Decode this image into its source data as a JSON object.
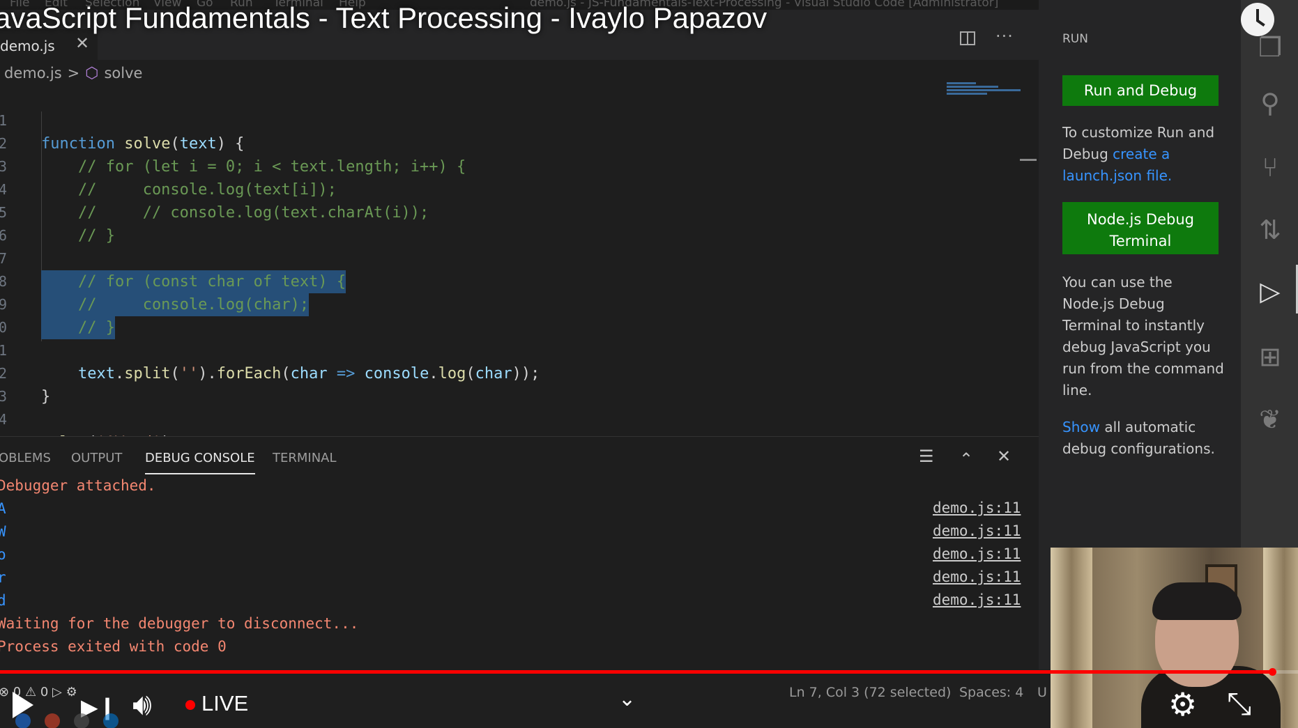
{
  "menubar": {
    "items": [
      "File",
      "Edit",
      "Selection",
      "View",
      "Go",
      "Run",
      "Terminal",
      "Help"
    ],
    "window_title": "demo.js - JS-Fundamentals-Text-Processing - Visual Studio Code [Administrator]"
  },
  "video": {
    "title": "avaScript Fundamentals - Text Processing - Ivaylo Papazov",
    "live_label": "LIVE",
    "progress": 0.98
  },
  "tab": {
    "label": "demo.js",
    "close": "✕"
  },
  "editor_actions": {
    "more": "···"
  },
  "breadcrumb": {
    "file": "demo.js",
    "separator": ">",
    "symbol": "solve"
  },
  "code_lines": [
    {
      "n": "1",
      "text": "function solve(text) {"
    },
    {
      "n": "2",
      "text": "    // for (let i = 0; i < text.length; i++) {"
    },
    {
      "n": "3",
      "text": "    //     console.log(text[i]);"
    },
    {
      "n": "4",
      "text": "    //     // console.log(text.charAt(i));"
    },
    {
      "n": "5",
      "text": "    // }"
    },
    {
      "n": "6",
      "text": ""
    },
    {
      "n": "7",
      "text": "    // for (const char of text) {"
    },
    {
      "n": "8",
      "text": "    //     console.log(char);"
    },
    {
      "n": "9",
      "text": "    // }"
    },
    {
      "n": "0",
      "text": ""
    },
    {
      "n": "1",
      "text": "    text.split('').forEach(char => console.log(char));"
    },
    {
      "n": "2",
      "text": "}"
    },
    {
      "n": "3",
      "text": ""
    },
    {
      "n": "4",
      "text": "solve('AWord');"
    }
  ],
  "panel": {
    "tabs": [
      "OBLEMS",
      "OUTPUT",
      "DEBUG CONSOLE",
      "TERMINAL"
    ],
    "active_tab": "DEBUG CONSOLE",
    "icons": {
      "clear": "☰",
      "maximize": "⌃",
      "close": "✕"
    },
    "console_lines": [
      {
        "text": "Debugger attached.",
        "kind": "red"
      },
      {
        "text": "A",
        "kind": "blue"
      },
      {
        "text": "W",
        "kind": "blue"
      },
      {
        "text": "o",
        "kind": "blue"
      },
      {
        "text": "r",
        "kind": "blue"
      },
      {
        "text": "d",
        "kind": "blue"
      },
      {
        "text": "Waiting for the debugger to disconnect...",
        "kind": "red"
      },
      {
        "text": "Process exited with code 0",
        "kind": "red"
      }
    ],
    "source_links": [
      "demo.js:11",
      "demo.js:11",
      "demo.js:11",
      "demo.js:11",
      "demo.js:11"
    ]
  },
  "run_view": {
    "title": "RUN",
    "run_debug_button": "Run and Debug",
    "customize_text": "To customize Run and Debug ",
    "customize_link": "create a launch.json file.",
    "node_terminal_button_line1": "Node.js Debug",
    "node_terminal_button_line2": "Terminal",
    "node_terminal_desc": "You can use the Node.js Debug Terminal to instantly debug JavaScript you run from the command line.",
    "show_link": "Show",
    "show_text": " all automatic debug configurations."
  },
  "status_bar": {
    "left": "⊗ 0 ⚠ 0   ▷  ⚙",
    "position": "Ln 7, Col 3 (72 selected)",
    "spaces": "Spaces: 4",
    "encoding_partial": "U"
  },
  "colors": {
    "accent_green": "#0e7a0d",
    "link_blue": "#3794ff",
    "console_red": "#f48771",
    "progress_red": "#ff0000"
  },
  "icons": {
    "activity": [
      "files-icon",
      "search-icon",
      "source-control-icon",
      "pull-request-icon",
      "run-debug-icon",
      "extensions-icon",
      "mongodb-leaf-icon"
    ]
  }
}
